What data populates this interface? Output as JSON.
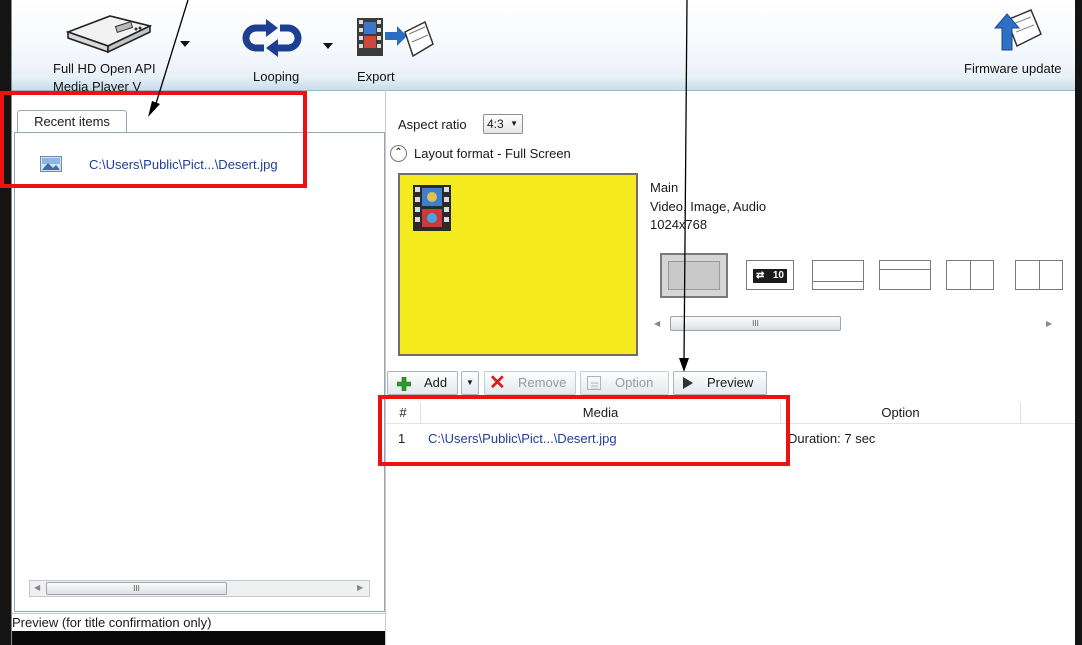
{
  "toolbar": {
    "device_label_line1": "Full HD Open API",
    "device_label_line2": "Media Player V",
    "looping_label": "Looping",
    "export_label": "Export",
    "firmware_label": "Firmware update"
  },
  "left_panel": {
    "tab_label": "Recent items",
    "recent_items": [
      {
        "path": "C:\\Users\\Public\\Pict...\\Desert.jpg",
        "icon": "image-icon"
      }
    ],
    "scroll_marker": "III",
    "preview_label": "Preview (for title confirmation only)"
  },
  "layout": {
    "aspect_ratio_label": "Aspect ratio",
    "aspect_ratio_value": "4:3",
    "layout_format_label": "Layout format - Full Screen",
    "zone_name": "Main",
    "zone_types": "Video, Image, Audio",
    "zone_resolution": "1024x768",
    "scroll_marker": "III",
    "ticker_badge": "10"
  },
  "media_toolbar": {
    "add_label": "Add",
    "remove_label": "Remove",
    "option_label": "Option",
    "preview_label": "Preview"
  },
  "media_table": {
    "columns": [
      "#",
      "Media",
      "Option"
    ],
    "rows": [
      {
        "num": "1",
        "media": "C:\\Users\\Public\\Pict...\\Desert.jpg",
        "option": "Duration: 7 sec"
      }
    ]
  },
  "colors": {
    "highlight_red": "#ee1111",
    "layout_yellow": "#f4ea1e",
    "looping_blue": "#1d3f8f",
    "add_green": "#2e9a2e",
    "remove_red": "#d42020"
  }
}
